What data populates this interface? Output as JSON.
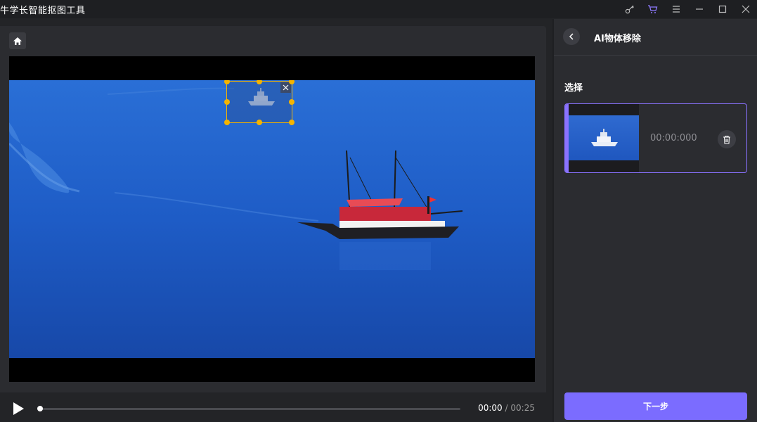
{
  "app": {
    "title": "牛学长智能抠图工具"
  },
  "window_controls": {
    "icons": [
      "key-icon",
      "cart-icon",
      "menu-icon",
      "minimize-icon",
      "maximize-icon",
      "close-icon"
    ],
    "accent_color": "#8f7bff"
  },
  "editor": {
    "home_icon": "home-icon",
    "selection_color": "#f5b400"
  },
  "playback": {
    "current_time": "00:00",
    "separator": "/",
    "total_time": "00:25",
    "progress": 0
  },
  "sidebar": {
    "title": "AI物体移除",
    "section_label": "选择",
    "clips": [
      {
        "timestamp": "00:00:000"
      }
    ],
    "next_button": "下一步",
    "accent_color": "#7b6cff"
  }
}
